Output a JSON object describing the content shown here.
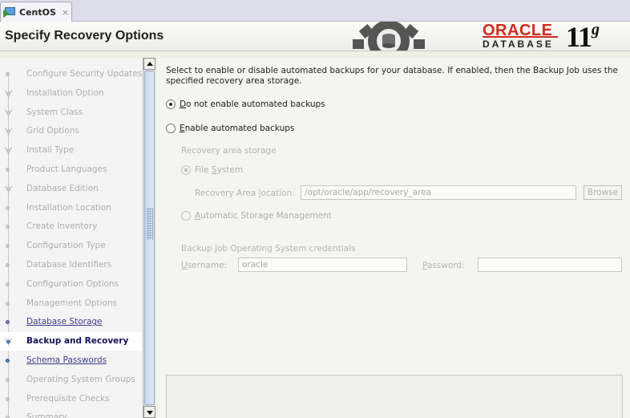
{
  "tab": {
    "label": "CentOS",
    "close": "×"
  },
  "header": {
    "title": "Specify Recovery Options",
    "logo_brand": "ORACLE",
    "logo_sub": "DATABASE",
    "version": "11",
    "version_sup": "g",
    "brand_color": "#d22a1f"
  },
  "sidebar": {
    "steps": [
      {
        "label": "Configure Security Updates",
        "state": "disabled",
        "icon": "dot"
      },
      {
        "label": "Installation Option",
        "state": "disabled",
        "icon": "fork"
      },
      {
        "label": "System Class",
        "state": "disabled",
        "icon": "fork"
      },
      {
        "label": "Grid Options",
        "state": "disabled",
        "icon": "fork"
      },
      {
        "label": "Install Type",
        "state": "disabled",
        "icon": "fork"
      },
      {
        "label": "Product Languages",
        "state": "disabled",
        "icon": "dot"
      },
      {
        "label": "Database Edition",
        "state": "disabled",
        "icon": "fork"
      },
      {
        "label": "Installation Location",
        "state": "disabled",
        "icon": "dot"
      },
      {
        "label": "Create Inventory",
        "state": "disabled",
        "icon": "dot"
      },
      {
        "label": "Configuration Type",
        "state": "disabled",
        "icon": "dot"
      },
      {
        "label": "Database Identifiers",
        "state": "disabled",
        "icon": "dot"
      },
      {
        "label": "Configuration Options",
        "state": "disabled",
        "icon": "dot"
      },
      {
        "label": "Management Options",
        "state": "disabled",
        "icon": "dot"
      },
      {
        "label": "Database Storage",
        "state": "done",
        "icon": "dot"
      },
      {
        "label": "Backup and Recovery",
        "state": "current",
        "icon": "fork"
      },
      {
        "label": "Schema Passwords",
        "state": "next",
        "icon": "dot"
      },
      {
        "label": "Operating System Groups",
        "state": "disabled",
        "icon": "dot"
      },
      {
        "label": "Prerequisite Checks",
        "state": "disabled",
        "icon": "dot"
      },
      {
        "label": "Summary",
        "state": "disabled",
        "icon": "dot"
      }
    ]
  },
  "main": {
    "description": "Select to enable or disable automated backups for your database. If enabled, then the Backup Job uses the specified recovery area storage.",
    "option_disable": {
      "mnemonic": "D",
      "rest": "o not enable automated backups",
      "checked": true
    },
    "option_enable": {
      "mnemonic": "E",
      "rest": "nable automated backups",
      "checked": false
    },
    "recovery_storage_label": "Recovery area storage",
    "file_system": {
      "pre": "File ",
      "mnemonic": "S",
      "rest": "ystem",
      "checked": true
    },
    "recovery_location": {
      "label_pre": "Recovery Area ",
      "label_mnemonic": "l",
      "label_rest": "ocation:",
      "value": "/opt/oracle/app/recovery_area"
    },
    "browse_label": "Browse",
    "asm": {
      "mnemonic": "A",
      "rest": "utomatic Storage Management",
      "checked": false
    },
    "credentials_label": "Backup Job Operating System credentials",
    "username": {
      "mnemonic": "U",
      "rest": "sername:",
      "value": "oracle"
    },
    "password": {
      "mnemonic": "P",
      "rest": "assword:",
      "value": ""
    }
  }
}
